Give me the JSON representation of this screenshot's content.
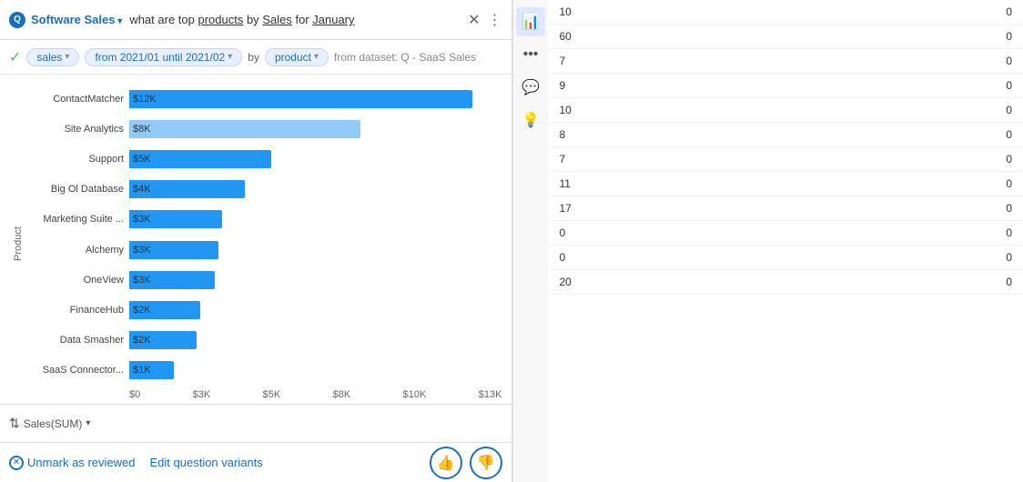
{
  "searchBar": {
    "datasource": "Software Sales",
    "query": "what are top products by Sales for January",
    "underlined": [
      "products",
      "Sales",
      "January"
    ]
  },
  "pills": {
    "checkIcon": "✓",
    "pill1": "sales",
    "pill2": "from 2021/01 until 2021/02",
    "byText": "by",
    "pill3": "product",
    "fromDataset": "from dataset: Q - SaaS Sales"
  },
  "yAxisLabel": "Product",
  "bars": [
    {
      "label": "ContactMatcher",
      "value": "$12K",
      "pct": 92
    },
    {
      "label": "Site Analytics",
      "value": "$8K",
      "pct": 62
    },
    {
      "label": "Support",
      "value": "$5K",
      "pct": 38
    },
    {
      "label": "Big Ol Database",
      "value": "$4K",
      "pct": 31
    },
    {
      "label": "Marketing Suite ...",
      "value": "$3K",
      "pct": 25
    },
    {
      "label": "Alchemy",
      "value": "$3K",
      "pct": 24
    },
    {
      "label": "OneView",
      "value": "$3K",
      "pct": 23
    },
    {
      "label": "FinanceHub",
      "value": "$2K",
      "pct": 19
    },
    {
      "label": "Data Smasher",
      "value": "$2K",
      "pct": 18
    },
    {
      "label": "SaaS Connector...",
      "value": "$1K",
      "pct": 12
    }
  ],
  "xAxisLabels": [
    "$0",
    "$3K",
    "$5K",
    "$8K",
    "$10K",
    "$13K"
  ],
  "sortLabel": "Sales(SUM)",
  "actionBar": {
    "unmarkLabel": "Unmark as reviewed",
    "editLabel": "Edit question variants"
  },
  "rightPanel": {
    "rows": [
      {
        "num": "10",
        "val": "0"
      },
      {
        "num": "60",
        "val": "0"
      },
      {
        "num": "7",
        "val": "0"
      },
      {
        "num": "9",
        "val": "0"
      },
      {
        "num": "10",
        "val": "0"
      },
      {
        "num": "8",
        "val": "0"
      },
      {
        "num": "7",
        "val": "0"
      },
      {
        "num": "11",
        "val": "0"
      },
      {
        "num": "17",
        "val": "0"
      },
      {
        "num": "0",
        "val": "0"
      },
      {
        "num": "0",
        "val": "0"
      },
      {
        "num": "20",
        "val": "0"
      }
    ]
  },
  "icons": {
    "chart": "📊",
    "dots": "⋯",
    "comment": "💬",
    "bulb": "💡"
  }
}
